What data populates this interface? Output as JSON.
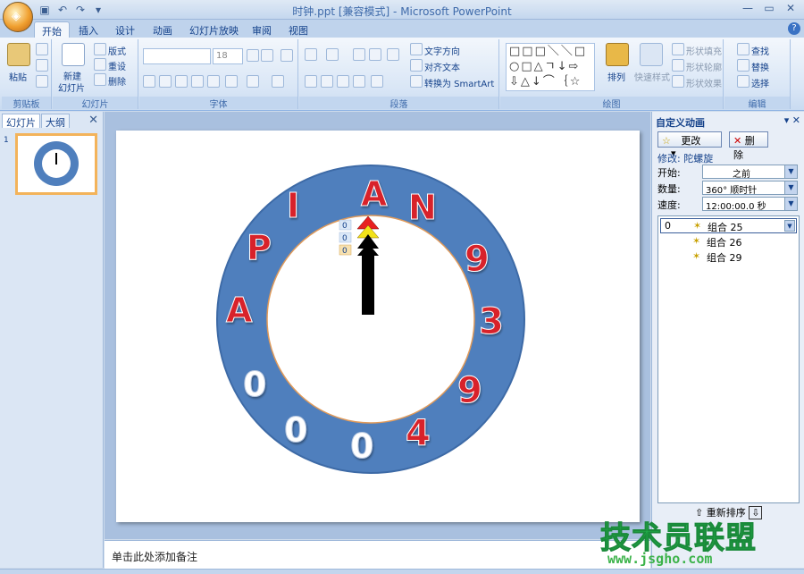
{
  "window": {
    "title": "时钟.ppt [兼容模式] - Microsoft PowerPoint"
  },
  "tabs": [
    "开始",
    "插入",
    "设计",
    "动画",
    "幻灯片放映",
    "审阅",
    "视图"
  ],
  "ribbon": {
    "clipboard": {
      "paste": "粘贴",
      "label": "剪贴板"
    },
    "slides": {
      "new_slide": "新建",
      "new_slide2": "幻灯片",
      "layout": "版式",
      "reset": "重设",
      "delete": "删除",
      "label": "幻灯片"
    },
    "font": {
      "size": "18",
      "label": "字体"
    },
    "paragraph": {
      "text_direction": "文字方向",
      "align_text": "对齐文本",
      "smartart": "转换为 SmartArt",
      "label": "段落"
    },
    "drawing": {
      "arrange": "排列",
      "quick_styles": "快速样式",
      "shape_fill": "形状填充",
      "shape_outline": "形状轮廓",
      "shape_effects": "形状效果",
      "label": "绘图"
    },
    "editing": {
      "find": "查找",
      "replace": "替换",
      "select": "选择",
      "label": "编辑"
    }
  },
  "left_panel": {
    "tab_slides": "幻灯片",
    "tab_outline": "大纲",
    "slide_number": "1"
  },
  "slide": {
    "clock_letters": [
      "A",
      "N",
      "9",
      "3",
      "9",
      "4",
      "0",
      "0",
      "0",
      "A",
      "P",
      "I"
    ],
    "tags": [
      "0",
      "0",
      "0"
    ],
    "colors": {
      "ring": "#4f7fbd",
      "letters_red": "#d8202a",
      "letters_white": "#ffffff",
      "inner_border": "#e09a5a"
    }
  },
  "notes": {
    "placeholder": "单击此处添加备注"
  },
  "task_pane": {
    "title": "自定义动画",
    "change_button": "更改",
    "remove_button": "删除",
    "modify": "修改: 陀螺旋",
    "start_label": "开始:",
    "start_value": "之前",
    "amount_label": "数量:",
    "amount_value": "360°  顺时针",
    "speed_label": "速度:",
    "speed_value": "12:00:00.0 秒",
    "items": [
      {
        "num": "0",
        "name": "组合 25"
      },
      {
        "num": "",
        "name": "组合 26"
      },
      {
        "num": "",
        "name": "组合 29"
      }
    ],
    "reorder": "重新排序"
  },
  "watermark": {
    "main": "技术员联盟",
    "url": "www.jsgho.com"
  }
}
